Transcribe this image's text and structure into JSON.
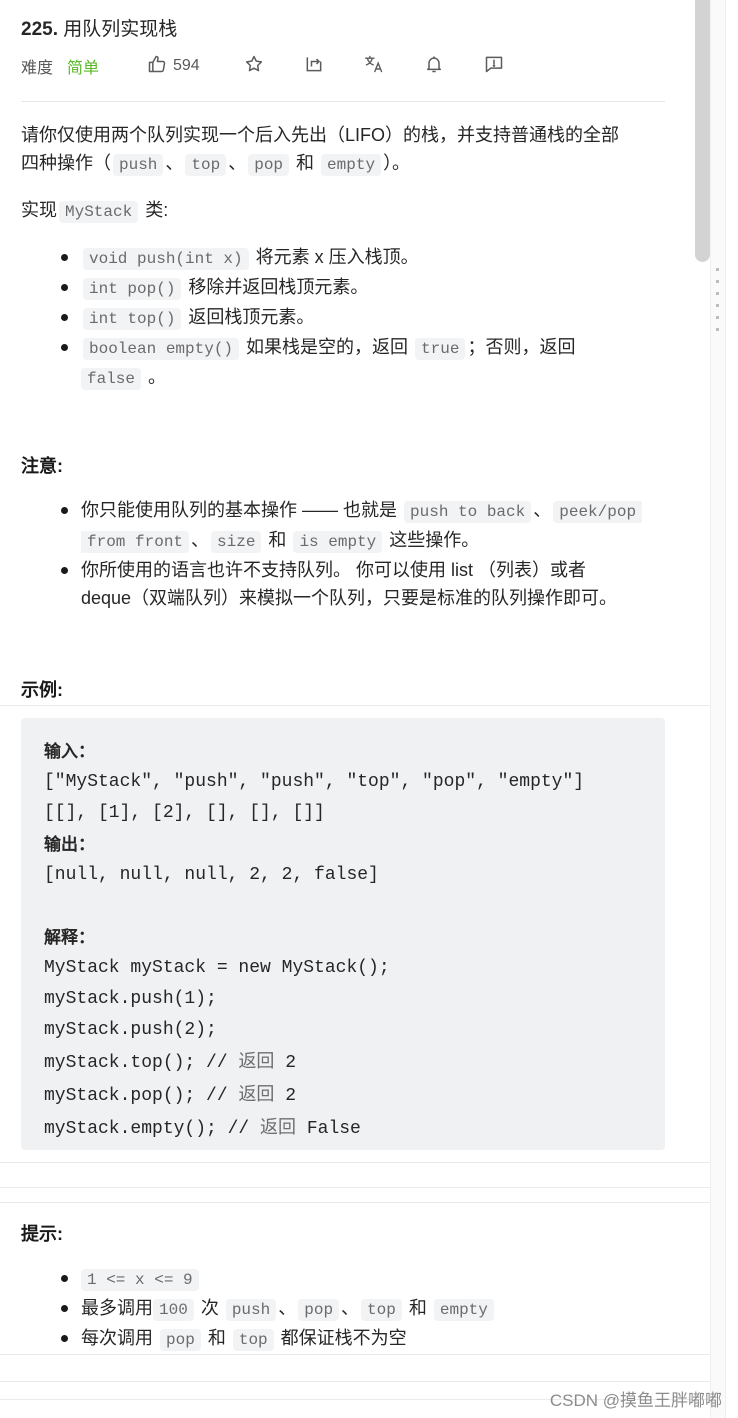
{
  "problem": {
    "number": "225.",
    "title": "用队列实现栈",
    "difficulty_label": "难度",
    "difficulty_value": "简单",
    "likes": "594",
    "colors": {
      "difficulty_easy": "#5ab726",
      "code_bg": "#f2f3f5"
    }
  },
  "toolbar": {
    "icons": [
      "thumbs-up-icon",
      "star-icon",
      "share-icon",
      "translate-icon",
      "bell-icon",
      "feedback-icon"
    ]
  },
  "description": {
    "intro_1": "请你仅使用两个队列实现一个后入先出（LIFO）的栈，并支持普通栈的全部",
    "intro_2_prefix": "四种操作（",
    "ops": [
      "push",
      "top",
      "pop",
      "empty"
    ],
    "sep": "、",
    "and": " 和 ",
    "intro_2_suffix": "）。",
    "implement_prefix": "实现",
    "implement_class": "MyStack",
    "implement_suffix": " 类:",
    "methods": [
      {
        "code": "void push(int x)",
        "text": " 将元素 x 压入栈顶。"
      },
      {
        "code": "int pop()",
        "text": " 移除并返回栈顶元素。"
      },
      {
        "code": "int top()",
        "text": " 返回栈顶元素。"
      },
      {
        "code": "boolean empty()",
        "text_1": " 如果栈是空的，返回 ",
        "code_true": "true",
        "text_2": "；否则，返回",
        "code_false": "false",
        "text_3": " 。"
      }
    ]
  },
  "notes": {
    "heading": "注意:",
    "item1_text_1": "你只能使用队列的基本操作 —— 也就是 ",
    "item1_code_1": "push to back",
    "item1_sep": "、",
    "item1_code_2": "peek/pop",
    "item1_code_2b": "from front",
    "item1_sep2": "、",
    "item1_code_3": "size",
    "item1_and": " 和 ",
    "item1_code_4": "is empty",
    "item1_text_2": " 这些操作。",
    "item2_line1": "你所使用的语言也许不支持队列。 你可以使用 list （列表）或者",
    "item2_line2": "deque（双端队列）来模拟一个队列，只要是标准的队列操作即可。"
  },
  "example": {
    "heading": "示例:",
    "input_label": "输入：",
    "input_line1": "[\"MyStack\", \"push\", \"push\", \"top\", \"pop\", \"empty\"]",
    "input_line2": "[[], [1], [2], [], [], []]",
    "output_label": "输出：",
    "output_line": "[null, null, null, 2, 2, false]",
    "explain_label": "解释：",
    "code_lines": [
      {
        "code": "MyStack myStack = new MyStack();",
        "comment": "",
        "value": ""
      },
      {
        "code": "myStack.push(1);",
        "comment": "",
        "value": ""
      },
      {
        "code": "myStack.push(2);",
        "comment": "",
        "value": ""
      },
      {
        "code": "myStack.top(); // ",
        "comment": "返回",
        "value": " 2"
      },
      {
        "code": "myStack.pop(); // ",
        "comment": "返回",
        "value": " 2"
      },
      {
        "code": "myStack.empty(); // ",
        "comment": "返回",
        "value": " False"
      }
    ]
  },
  "hints": {
    "heading": "提示:",
    "constraint": "1 <= x <= 9",
    "item2_prefix": "最多调用",
    "item2_count": "100",
    "item2_mid": " 次 ",
    "item2_ops": [
      "push",
      "pop",
      "top",
      "empty"
    ],
    "item2_sep": "、",
    "item2_and": " 和 ",
    "item3_prefix": "每次调用 ",
    "item3_code_1": "pop",
    "item3_and": " 和 ",
    "item3_code_2": "top",
    "item3_suffix": " 都保证栈不为空"
  },
  "watermark": "CSDN @摸鱼王胖嘟嘟"
}
